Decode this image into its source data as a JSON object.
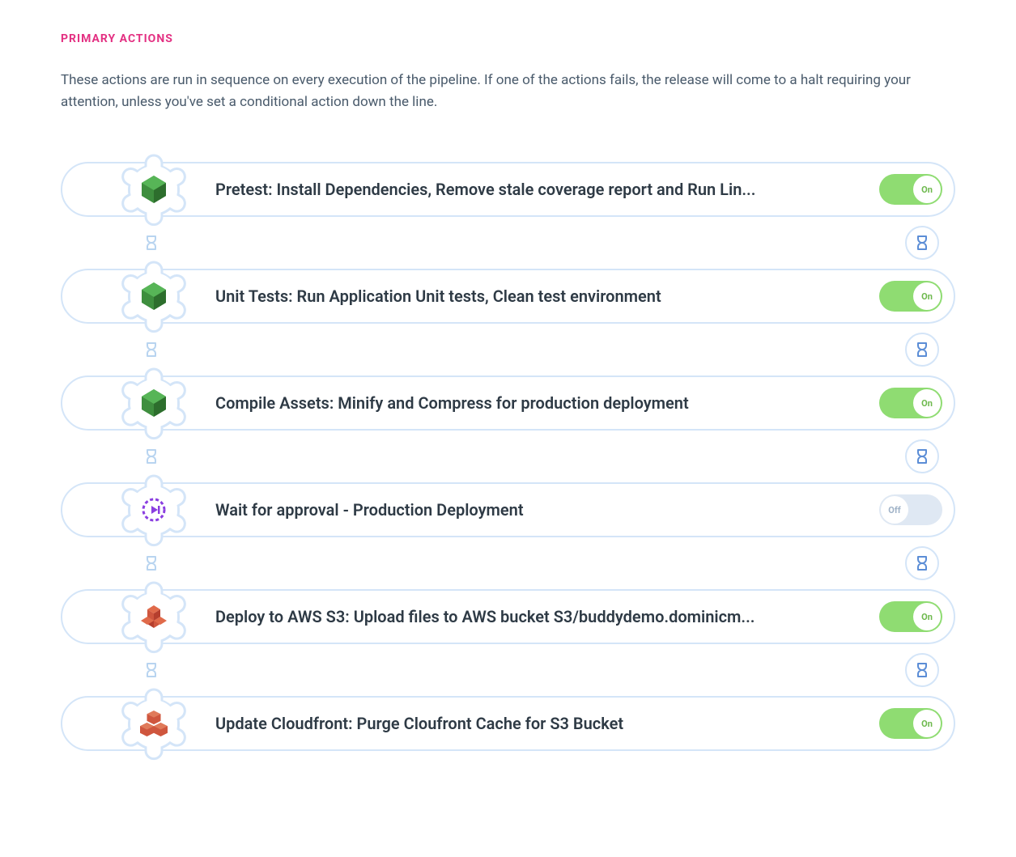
{
  "heading": "PRIMARY ACTIONS",
  "description": "These actions are run in sequence on every execution of the pipeline. If one of the actions fails, the release will come to a halt requiring your attention, unless you've set a conditional action down the line.",
  "toggle_labels": {
    "on": "On",
    "off": "Off"
  },
  "actions": [
    {
      "icon": "nodejs",
      "title": "Pretest: Install Dependencies, Remove stale coverage report and Run Lin...",
      "state": "on"
    },
    {
      "icon": "nodejs",
      "title": "Unit Tests: Run Application Unit tests, Clean test environment",
      "state": "on"
    },
    {
      "icon": "nodejs",
      "title": "Compile Assets: Minify and Compress for production deployment",
      "state": "on"
    },
    {
      "icon": "wait",
      "title": "Wait for approval - Production Deployment",
      "state": "off"
    },
    {
      "icon": "aws-s3",
      "title": "Deploy to AWS S3: Upload files to AWS bucket S3/buddydemo.dominicm...",
      "state": "on"
    },
    {
      "icon": "aws-cf",
      "title": "Update Cloudfront: Purge Cloufront Cache for S3 Bucket",
      "state": "on"
    }
  ]
}
